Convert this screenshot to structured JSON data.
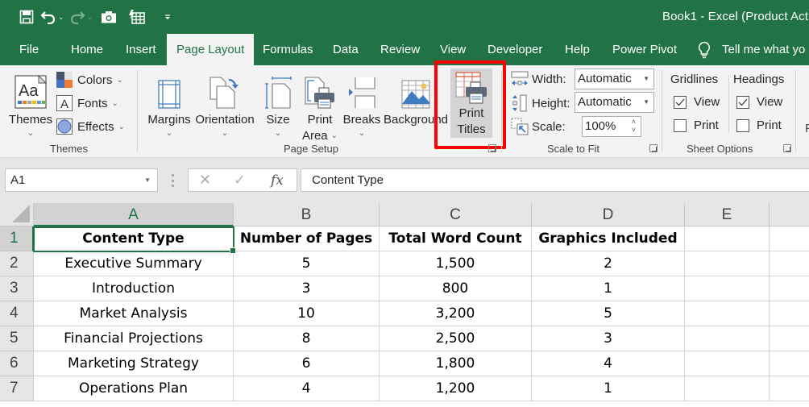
{
  "window": {
    "title": "Book1  -  Excel (Product Act"
  },
  "quick_access": {
    "items": [
      {
        "name": "save",
        "icon": "save-icon"
      },
      {
        "name": "undo",
        "icon": "undo-icon"
      },
      {
        "name": "redo",
        "icon": "redo-icon",
        "disabled": true
      },
      {
        "name": "camera",
        "icon": "camera-icon"
      },
      {
        "name": "form",
        "icon": "form-icon"
      },
      {
        "name": "customize",
        "icon": "customize-qat-icon"
      }
    ]
  },
  "menu": {
    "tabs": [
      "File",
      "Home",
      "Insert",
      "Page Layout",
      "Formulas",
      "Data",
      "Review",
      "View",
      "Developer",
      "Help",
      "Power Pivot"
    ],
    "active_tab": "Page Layout",
    "tell_me": "Tell me what yo"
  },
  "ribbon": {
    "themes_group": {
      "label": "Themes",
      "themes_button": "Themes",
      "colors": "Colors",
      "fonts": "Fonts",
      "effects": "Effects"
    },
    "page_setup_group": {
      "label": "Page Setup",
      "margins": "Margins",
      "orientation": "Orientation",
      "size": "Size",
      "print_area_line1": "Print",
      "print_area_line2": "Area",
      "breaks": "Breaks",
      "background": "Background",
      "print_titles_line1": "Print",
      "print_titles_line2": "Titles"
    },
    "scale_group": {
      "label": "Scale to Fit",
      "width_label": "Width:",
      "width_value": "Automatic",
      "height_label": "Height:",
      "height_value": "Automatic",
      "scale_label": "Scale:",
      "scale_value": "100%"
    },
    "sheet_options_group": {
      "label": "Sheet Options",
      "gridlines": "Gridlines",
      "headings": "Headings",
      "view": "View",
      "print": "Print",
      "gridlines_view": true,
      "gridlines_print": false,
      "headings_view": true,
      "headings_print": false
    },
    "overflow_char": "F"
  },
  "formula_bar": {
    "name_box": "A1",
    "cancel_symbol": "✕",
    "enter_symbol": "✓",
    "fx_label": "fx",
    "content": "Content Type"
  },
  "sheet": {
    "columns": [
      "A",
      "B",
      "C",
      "D",
      "E",
      ""
    ],
    "selected_column": "A",
    "rows": [
      "1",
      "2",
      "3",
      "4",
      "5",
      "6",
      "7"
    ],
    "selected_row": "1",
    "active_cell": "A1",
    "header": [
      "Content Type",
      "Number of Pages",
      "Total Word Count",
      "Graphics Included"
    ],
    "data": [
      [
        "Executive Summary",
        "5",
        "1,500",
        "2"
      ],
      [
        "Introduction",
        "3",
        "800",
        "1"
      ],
      [
        "Market Analysis",
        "10",
        "3,200",
        "5"
      ],
      [
        "Financial Projections",
        "8",
        "2,500",
        "3"
      ],
      [
        "Marketing Strategy",
        "6",
        "1,800",
        "4"
      ],
      [
        "Operations Plan",
        "4",
        "1,200",
        "1"
      ]
    ]
  },
  "colors": {
    "excel_green": "#217346",
    "highlight_red": "#ff0000",
    "ribbon_bg": "#f3f3f3"
  }
}
